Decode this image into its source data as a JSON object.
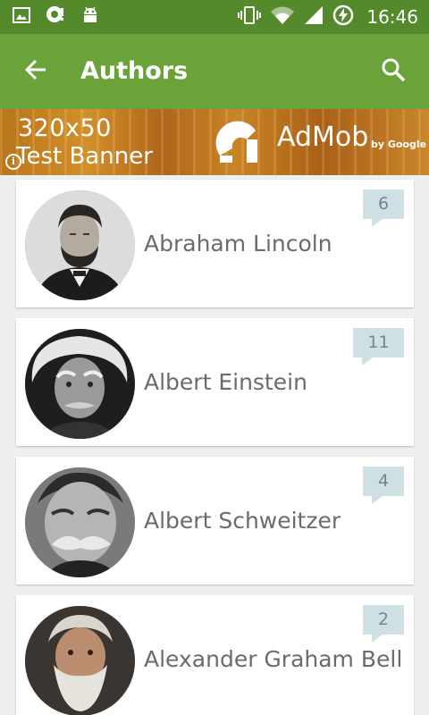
{
  "status_bar": {
    "time": "16:46",
    "left_icons": [
      "image-icon",
      "speech-bubble-icon",
      "android-icon"
    ],
    "right_icons": [
      "vibrate-icon",
      "wifi-icon",
      "signal-icon",
      "battery-charging-icon"
    ]
  },
  "app_bar": {
    "title": "Authors",
    "back_icon": "arrow-back-icon",
    "search_icon": "search-icon",
    "color": "#6aa339",
    "status_color": "#548a2b"
  },
  "ad": {
    "line1": "320x50",
    "line2": "Test Banner",
    "brand": "AdMob",
    "by": "by Google",
    "info_icon": "info-icon"
  },
  "authors": [
    {
      "name": "Abraham Lincoln",
      "count": "6"
    },
    {
      "name": "Albert Einstein",
      "count": "11"
    },
    {
      "name": "Albert Schweitzer",
      "count": "4"
    },
    {
      "name": "Alexander Graham Bell",
      "count": "2"
    }
  ],
  "colors": {
    "badge_bg": "#cfe0e5",
    "badge_text": "#6f8790",
    "name_text": "#6b6b6b"
  }
}
